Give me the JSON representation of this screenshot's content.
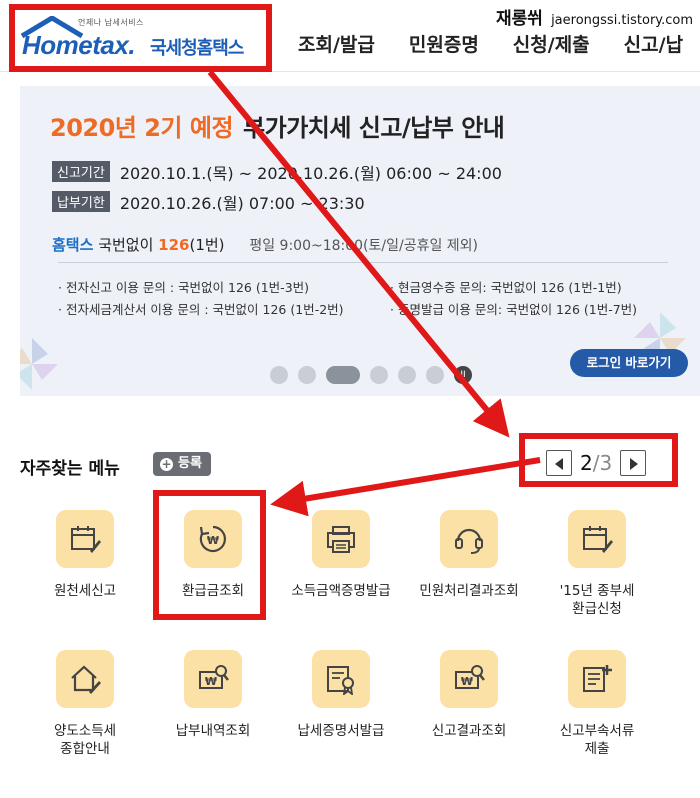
{
  "header": {
    "logo_tagline": "언제나 납세서비스",
    "logo_brand": "Hometax.",
    "logo_brand_kr": "국세청홈택스",
    "nav": [
      "조회/발급",
      "민원증명",
      "신청/제출",
      "신고/납"
    ],
    "watermark_kr": "재롱쒸",
    "watermark_url": "jaerongssi.tistory.com"
  },
  "banner": {
    "title_orange": "2020년 2기 예정",
    "title_dark": "부가가치세 신고/납부 안내",
    "filing_label": "신고기간",
    "filing_period": "2020.10.1.(목) ~ 2020.10.26.(월) 06:00 ~ 24:00",
    "payment_label": "납부기한",
    "payment_period": "2020.10.26.(월) 07:00 ~ 23:30",
    "hometax": "홈택스",
    "phone_prefix": "국번없이",
    "phone_number": "126",
    "phone_suffix": "(1번)",
    "hours": "평일 9:00~18:00(토/일/공휴일 제외)",
    "inquiries": [
      "· 전자신고 이용 문의 : 국번없이 126 (1번-3번)",
      "· 현금영수증 문의: 국번없이 126 (1번-1번)",
      "· 전자세금계산서 이용 문의 : 국번없이 126 (1번-2번)",
      "· 증명발급 이용 문의: 국번없이 126 (1번-7번)"
    ],
    "login_button": "로그인 바로가기",
    "pause_symbol": "II"
  },
  "favorites": {
    "title": "자주찾는 메뉴",
    "register_button": "등록",
    "register_plus": "+",
    "page_current": "2",
    "page_separator": "/",
    "page_total": "3",
    "items": [
      {
        "label": "원천세신고",
        "icon": "calendar-pen-icon"
      },
      {
        "label": "환급금조회",
        "icon": "won-refresh-icon"
      },
      {
        "label": "소득금액증명발급",
        "icon": "printer-icon"
      },
      {
        "label": "민원처리결과조회",
        "icon": "headset-icon"
      },
      {
        "label": "'15년 종부세\n환급신청",
        "icon": "calendar-pen-icon"
      },
      {
        "label": "양도소득세\n종합안내",
        "icon": "house-pen-icon"
      },
      {
        "label": "납부내역조회",
        "icon": "won-search-icon"
      },
      {
        "label": "납세증명서발급",
        "icon": "certificate-icon"
      },
      {
        "label": "신고결과조회",
        "icon": "won-search-icon"
      },
      {
        "label": "신고부속서류\n제출",
        "icon": "document-plus-icon"
      }
    ]
  },
  "colors": {
    "brand_blue": "#1d5fb6",
    "orange": "#ef6a24",
    "annotation_red": "#e01818",
    "icon_bg": "#fbe1a6"
  }
}
